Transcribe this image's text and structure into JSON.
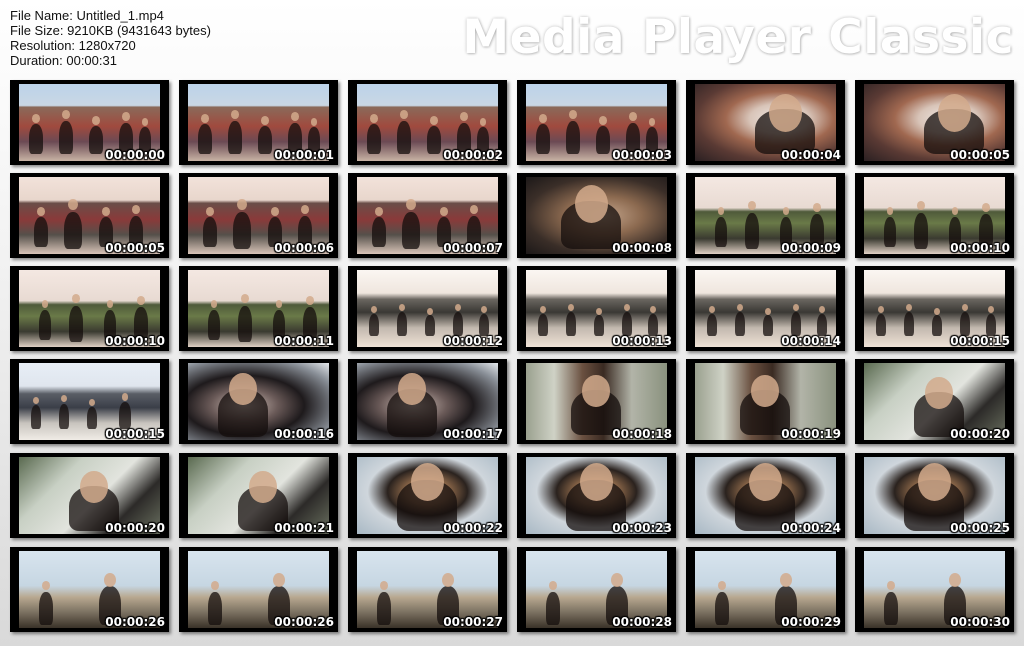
{
  "file_info": {
    "name_line": "File Name: Untitled_1.mp4",
    "size_line": "File Size: 9210KB (9431643 bytes)",
    "resolution_line": "Resolution: 1280x720",
    "duration_line": "Duration: 00:00:31"
  },
  "brand": "Media Player Classic",
  "thumbnails": [
    {
      "time": "00:00:00",
      "scene": "crowd"
    },
    {
      "time": "00:00:01",
      "scene": "crowd"
    },
    {
      "time": "00:00:02",
      "scene": "crowd"
    },
    {
      "time": "00:00:03",
      "scene": "crowd"
    },
    {
      "time": "00:00:04",
      "scene": "elder"
    },
    {
      "time": "00:00:05",
      "scene": "elder"
    },
    {
      "time": "00:00:05",
      "scene": "dance"
    },
    {
      "time": "00:00:06",
      "scene": "dance"
    },
    {
      "time": "00:00:07",
      "scene": "dance"
    },
    {
      "time": "00:00:08",
      "scene": "closeup"
    },
    {
      "time": "00:00:09",
      "scene": "green"
    },
    {
      "time": "00:00:10",
      "scene": "green"
    },
    {
      "time": "00:00:10",
      "scene": "green"
    },
    {
      "time": "00:00:11",
      "scene": "green"
    },
    {
      "time": "00:00:12",
      "scene": "field"
    },
    {
      "time": "00:00:13",
      "scene": "field"
    },
    {
      "time": "00:00:14",
      "scene": "field"
    },
    {
      "time": "00:00:15",
      "scene": "field"
    },
    {
      "time": "00:00:15",
      "scene": "field2"
    },
    {
      "time": "00:00:16",
      "scene": "woman"
    },
    {
      "time": "00:00:17",
      "scene": "woman"
    },
    {
      "time": "00:00:18",
      "scene": "boy"
    },
    {
      "time": "00:00:19",
      "scene": "boy"
    },
    {
      "time": "00:00:20",
      "scene": "palm"
    },
    {
      "time": "00:00:20",
      "scene": "palm"
    },
    {
      "time": "00:00:21",
      "scene": "palm"
    },
    {
      "time": "00:00:22",
      "scene": "man"
    },
    {
      "time": "00:00:23",
      "scene": "man"
    },
    {
      "time": "00:00:24",
      "scene": "man"
    },
    {
      "time": "00:00:25",
      "scene": "man"
    },
    {
      "time": "00:00:26",
      "scene": "sea"
    },
    {
      "time": "00:00:26",
      "scene": "sea"
    },
    {
      "time": "00:00:27",
      "scene": "sea"
    },
    {
      "time": "00:00:28",
      "scene": "sea"
    },
    {
      "time": "00:00:29",
      "scene": "sea"
    },
    {
      "time": "00:00:30",
      "scene": "sea"
    }
  ]
}
